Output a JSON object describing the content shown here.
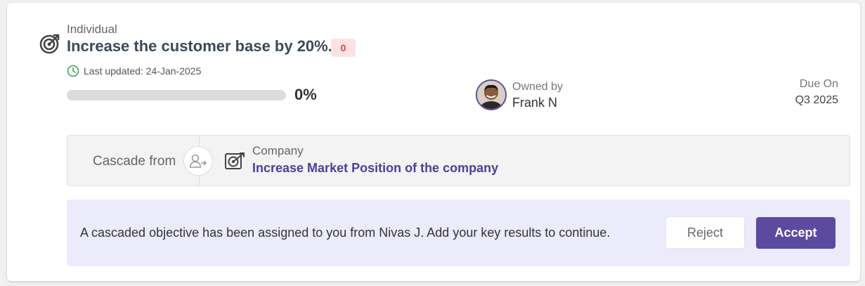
{
  "objective": {
    "type": "Individual",
    "title": "Increase the customer base by 20%.",
    "badge_count": "0",
    "last_updated": "Last updated: 24-Jan-2025",
    "progress_value": 0,
    "progress_label": "0%"
  },
  "owner": {
    "label": "Owned by",
    "name": "Frank N"
  },
  "due": {
    "label": "Due On",
    "value": "Q3 2025"
  },
  "cascade": {
    "label": "Cascade from",
    "parent_type": "Company",
    "parent_title": "Increase Market Position of the company"
  },
  "notice": {
    "message": "A cascaded objective has been assigned to you from Nivas J. Add your key results to continue.",
    "reject_label": "Reject",
    "accept_label": "Accept"
  },
  "colors": {
    "accent": "#5b4aa0",
    "badge_bg": "#fde2e2",
    "badge_text": "#e0443b",
    "notice_bg": "#ecebfc",
    "updated_icon": "#3aa655"
  },
  "icons": {
    "objective": "target-arrow-icon",
    "updated": "clock-icon",
    "cascade_node": "user-transfer-icon",
    "company": "target-arrow-icon"
  }
}
